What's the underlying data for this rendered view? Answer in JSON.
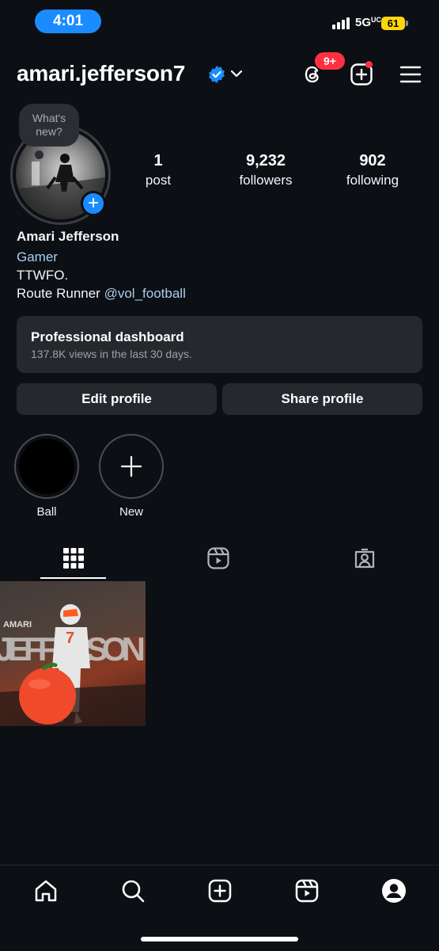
{
  "status_bar": {
    "time": "4:01",
    "network": "5G",
    "battery": "61"
  },
  "header": {
    "username": "amari.jefferson7",
    "threads_badge": "9+"
  },
  "profile": {
    "note": "What's new?",
    "stats": [
      {
        "value": "1",
        "label": "post"
      },
      {
        "value": "9,232",
        "label": "followers"
      },
      {
        "value": "902",
        "label": "following"
      }
    ],
    "name": "Amari Jefferson",
    "category": "Gamer",
    "bio_line1": "TTWFO.",
    "bio_line2_prefix": "Route Runner ",
    "bio_mention": "@vol_football"
  },
  "dashboard": {
    "title": "Professional dashboard",
    "subtitle": "137.8K views in the last 30 days."
  },
  "buttons": {
    "edit": "Edit profile",
    "share": "Share profile"
  },
  "highlights": [
    {
      "label": "Ball"
    },
    {
      "label": "New"
    }
  ],
  "post": {
    "text_small": "AMARI",
    "text_big": "JEFFERSON",
    "jersey": "7"
  },
  "colors": {
    "accent": "#1a8cff",
    "badge": "#ff3040",
    "link": "#a9cdf2",
    "background": "#0c0f14"
  }
}
